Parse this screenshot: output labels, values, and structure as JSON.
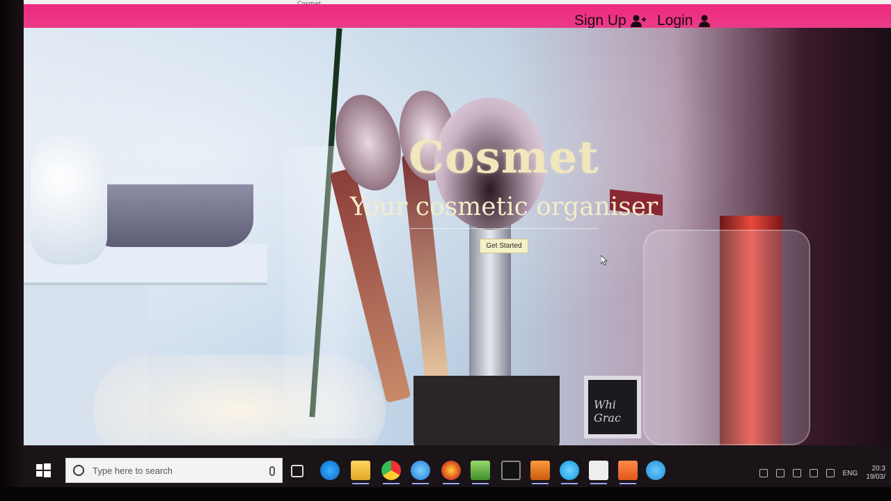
{
  "browser": {
    "tab_title": "Cosmet"
  },
  "nav": {
    "signup_label": "Sign Up",
    "login_label": "Login",
    "background_color": "#e8408a"
  },
  "hero": {
    "title": "Cosmet",
    "subtitle": "Your cosmetic organiser",
    "cta_label": "Get Started",
    "sign_text": "Whi Grac"
  },
  "taskbar": {
    "search_placeholder": "Type here to search",
    "apps": [
      "task-view",
      "edge",
      "file-explorer",
      "chrome",
      "internet-explorer",
      "firefox",
      "notepad",
      "terminal",
      "sublime-text",
      "skype",
      "mail",
      "xampp",
      "telegram"
    ],
    "tray": {
      "language": "ENG",
      "time": "20:3",
      "date": "19/03/"
    }
  },
  "colors": {
    "accent_pink": "#e8408a",
    "title_cream": "#f0e8bc",
    "taskbar": "#1a1418"
  }
}
